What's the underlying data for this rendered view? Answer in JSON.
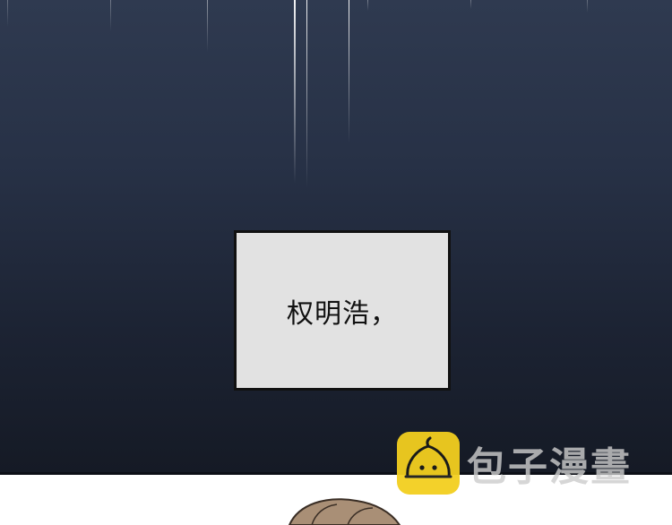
{
  "caption": {
    "text": "权明浩，"
  },
  "watermark": {
    "brand_name": "包子漫畫",
    "logo_icon": "bun-face-icon",
    "logo_color": "#f3cf1f"
  },
  "colors": {
    "sky_top": "#2f3a50",
    "sky_bottom": "#151a25",
    "caption_bg": "#e2e2e2",
    "caption_border": "#111111"
  }
}
